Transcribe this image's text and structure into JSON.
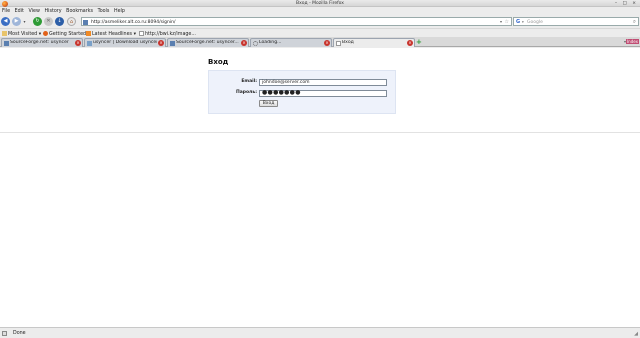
{
  "window": {
    "title": "Вход - Mozilla Firefox",
    "controls": "– □ ×"
  },
  "menu": [
    "File",
    "Edit",
    "View",
    "History",
    "Bookmarks",
    "Tools",
    "Help"
  ],
  "nav": {
    "url": "http://asmeliker.alt.co.ru:8094/signin/",
    "search_placeholder": "Google"
  },
  "bookmarks": [
    {
      "label": "Most Visited ▾"
    },
    {
      "label": "Getting Started"
    },
    {
      "label": "Latest Headlines ▾"
    },
    {
      "label": "http://bwi.kz/image..."
    }
  ],
  "tabs": [
    {
      "label": "SourceForge.net: usyncer"
    },
    {
      "label": "usyncer | Download usyncer..."
    },
    {
      "label": "SourceForge.net: usyncer..."
    },
    {
      "label": "Loading..."
    },
    {
      "label": "Вход"
    }
  ],
  "tab_tag": "Index",
  "page": {
    "heading": "Вход",
    "email_label": "Email:",
    "email_value": "johndoe@server.com",
    "password_label": "Пароль:",
    "password_mask": "●●●●●●●",
    "submit_label": "Вход"
  },
  "status": {
    "text": "Done"
  },
  "colors": {
    "form_bg": "#eef2fb",
    "close_red": "#c8332c",
    "accent_blue": "#3b6fc4"
  }
}
